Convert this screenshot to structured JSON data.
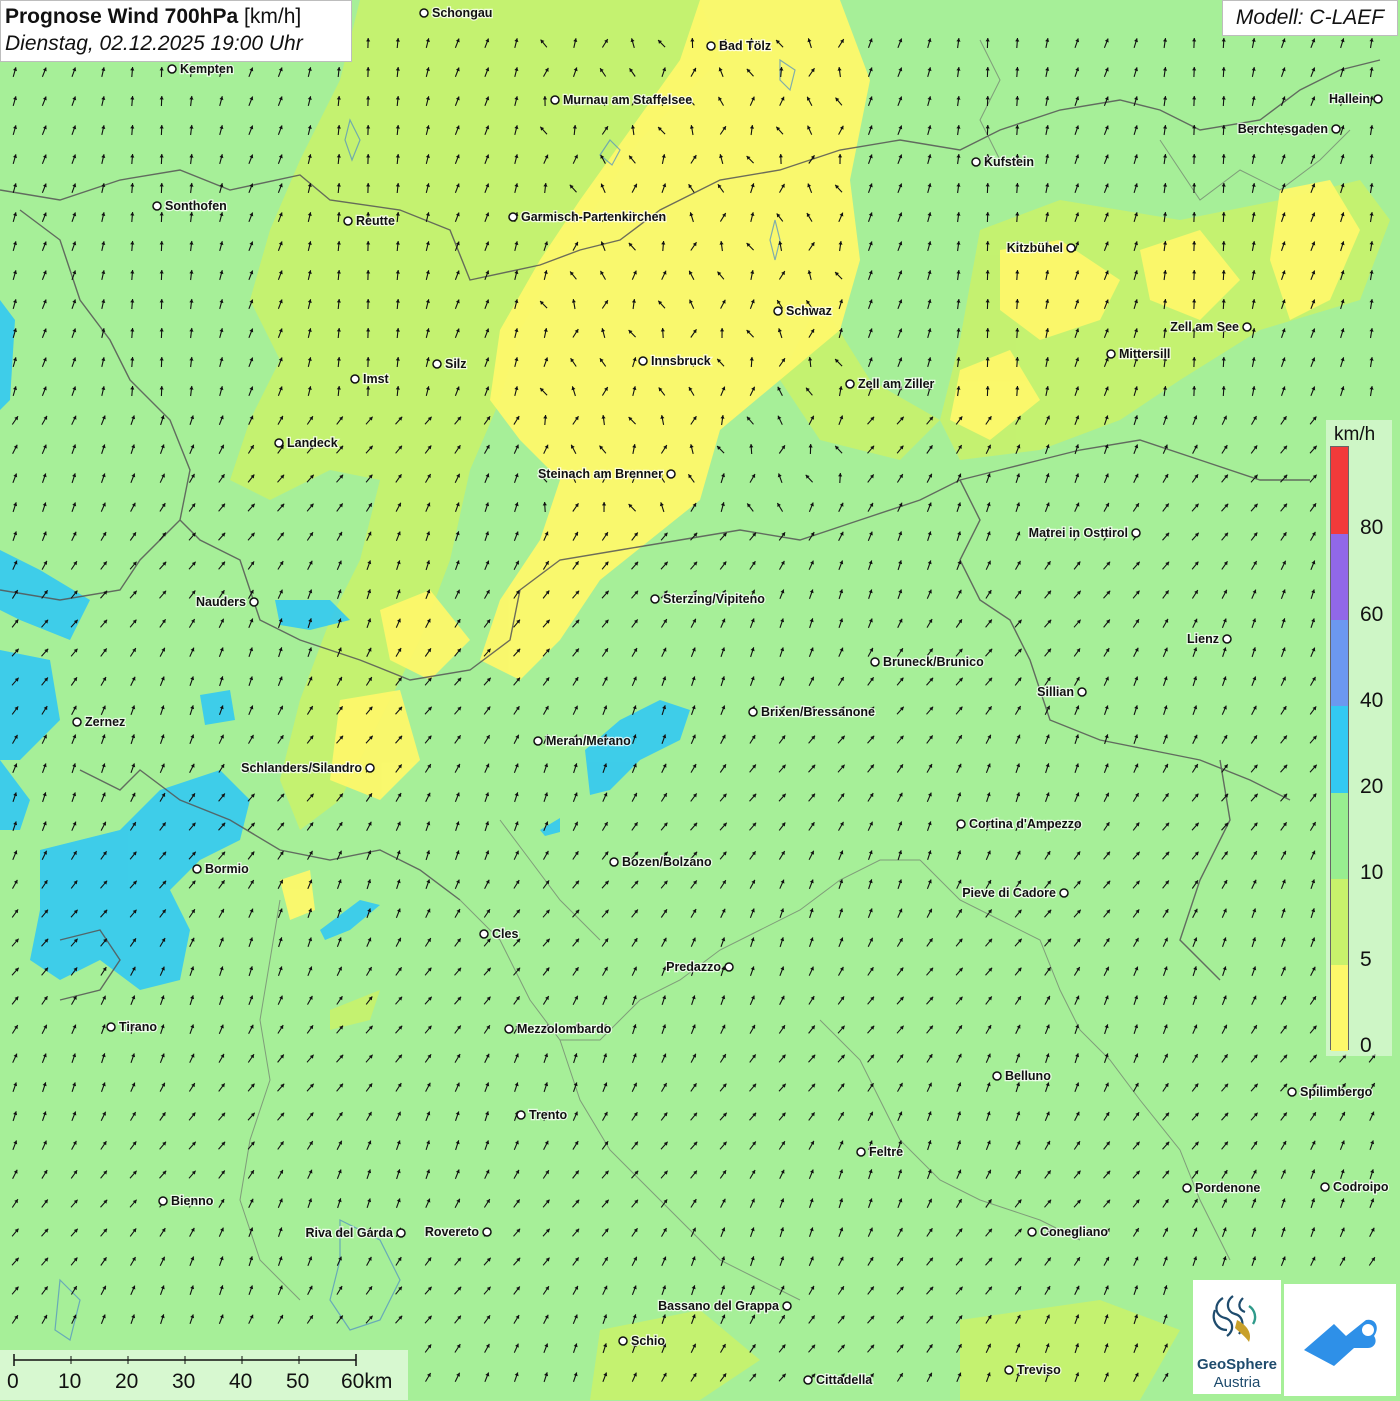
{
  "header": {
    "title_bold": "Prognose Wind 700hPa",
    "title_unit": "[km/h]",
    "datetime": "Dienstag, 02.12.2025 19:00 Uhr",
    "model": "Modell: C-LAEF"
  },
  "legend": {
    "unit": "km/h",
    "ticks": [
      "0",
      "5",
      "10",
      "20",
      "40",
      "60",
      "80"
    ],
    "colors": [
      "#fdf86a",
      "#c8f26c",
      "#98ee90",
      "#33c9f2",
      "#6c98f0",
      "#9168e8",
      "#f23a3a"
    ]
  },
  "scalebar": {
    "labels": [
      "0",
      "10",
      "20",
      "30",
      "40",
      "50",
      "60km"
    ]
  },
  "logos": {
    "geosphere_line1": "GeoSphere",
    "geosphere_line2": "Austria"
  },
  "map": {
    "colors": {
      "background": "#a6ef98",
      "calm": "#fdf86a",
      "weak": "#c8f26c",
      "moderate": "#98ee90",
      "strong": "#33c9f2",
      "arrow": "#111111",
      "border": "#555555"
    },
    "cities": [
      {
        "name": "Schongau"
      },
      {
        "name": "Bad Tölz"
      },
      {
        "name": "Kempten"
      },
      {
        "name": "Murnau am Staffelsee"
      },
      {
        "name": "Hallein"
      },
      {
        "name": "Berchtesgaden"
      },
      {
        "name": "Kufstein"
      },
      {
        "name": "Sonthofen"
      },
      {
        "name": "Reutte"
      },
      {
        "name": "Garmisch-Partenkirchen"
      },
      {
        "name": "Kitzbühel"
      },
      {
        "name": "Schwaz"
      },
      {
        "name": "Zell am See"
      },
      {
        "name": "Mittersill"
      },
      {
        "name": "Innsbruck"
      },
      {
        "name": "Imst"
      },
      {
        "name": "Silz"
      },
      {
        "name": "Zell am Ziller"
      },
      {
        "name": "Landeck"
      },
      {
        "name": "Steinach am Brenner"
      },
      {
        "name": "Matrei in Osttirol"
      },
      {
        "name": "Nauders"
      },
      {
        "name": "Sterzing/Vipiteno"
      },
      {
        "name": "Lienz"
      },
      {
        "name": "Bruneck/Brunico"
      },
      {
        "name": "Sillian"
      },
      {
        "name": "Zernez"
      },
      {
        "name": "Brixen/Bressanone"
      },
      {
        "name": "Meran/Merano"
      },
      {
        "name": "Schlanders/Silandro"
      },
      {
        "name": "Cortina d'Ampezzo"
      },
      {
        "name": "Bozen/Bolzano"
      },
      {
        "name": "Bormio"
      },
      {
        "name": "Pieve di Cadore"
      },
      {
        "name": "Cles"
      },
      {
        "name": "Predazzo"
      },
      {
        "name": "Tirano"
      },
      {
        "name": "Mezzolombardo"
      },
      {
        "name": "Belluno"
      },
      {
        "name": "Spilimbergo"
      },
      {
        "name": "Trento"
      },
      {
        "name": "Feltre"
      },
      {
        "name": "Bienno"
      },
      {
        "name": "Pordenone"
      },
      {
        "name": "Codroipo"
      },
      {
        "name": "Riva del Garda"
      },
      {
        "name": "Rovereto"
      },
      {
        "name": "Conegliano"
      },
      {
        "name": "Bassano del Grappa"
      },
      {
        "name": "Schio"
      },
      {
        "name": "Treviso"
      },
      {
        "name": "Cittadella"
      }
    ]
  }
}
